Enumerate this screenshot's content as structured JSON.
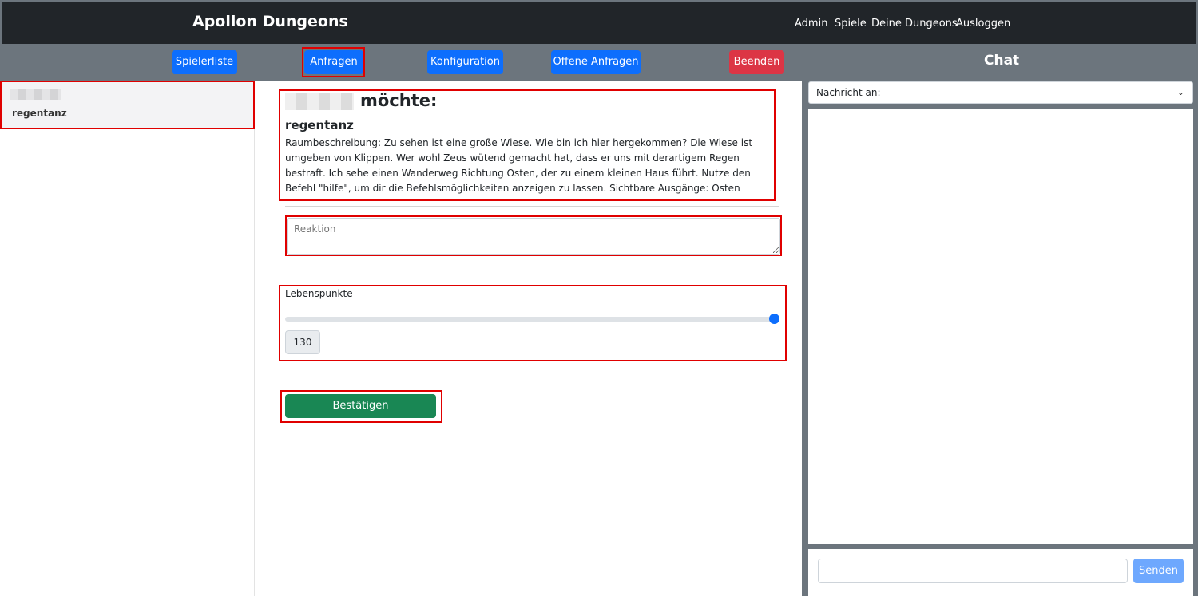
{
  "navbar": {
    "brand": "Apollon Dungeons",
    "links": [
      "Admin",
      "Spiele",
      "Deine Dungeons",
      "Ausloggen"
    ]
  },
  "toolbar": {
    "buttons": [
      "Spielerliste",
      "Anfragen",
      "Konfiguration",
      "Offene Anfragen",
      "Beenden"
    ],
    "chat_title": "Chat"
  },
  "player_list": {
    "items": [
      {
        "action": "regentanz"
      }
    ]
  },
  "request": {
    "title_suffix": "möchte:",
    "action": "regentanz",
    "description": "Raumbeschreibung: Zu sehen ist eine große Wiese. Wie bin ich hier hergekommen? Die Wiese ist umgeben von Klippen. Wer wohl Zeus wütend gemacht hat, dass er uns mit derartigem Regen bestraft. Ich sehe einen Wanderweg Richtung Osten, der zu einem kleinen Haus führt. Nutze den Befehl \"hilfe\", um dir die Befehlsmöglichkeiten anzeigen zu lassen. Sichtbare Ausgänge: Osten"
  },
  "reaction": {
    "placeholder": "Reaktion"
  },
  "hp": {
    "label": "Lebenspunkte",
    "value": "130",
    "slider_fraction": 1.0
  },
  "confirm_label": "Bestätigen",
  "chat": {
    "recipient_placeholder": "Nachricht an:",
    "send_label": "Senden"
  },
  "colors": {
    "navbar": "#212529",
    "toolbar": "#6c757d",
    "primary": "#0d6efd",
    "danger": "#dc3545",
    "success": "#198754",
    "highlight": "#e00000"
  }
}
